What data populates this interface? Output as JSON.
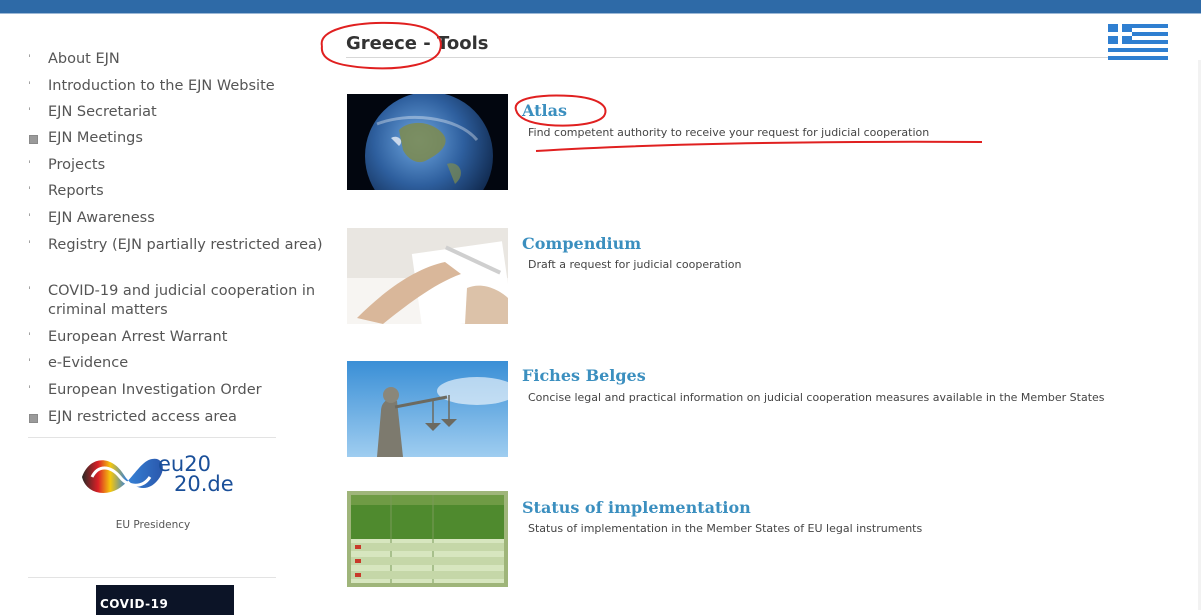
{
  "sidebar": {
    "items": [
      {
        "label": "About EJN"
      },
      {
        "label": "Introduction to the EJN Website"
      },
      {
        "label": "EJN Secretariat"
      },
      {
        "label": "EJN Meetings"
      },
      {
        "label": "Projects"
      },
      {
        "label": "Reports"
      },
      {
        "label": "EJN Awareness"
      },
      {
        "label": "Registry (EJN partially restricted area)"
      },
      {
        "label": "COVID-19 and judicial cooperation in criminal matters"
      },
      {
        "label": "European Arrest Warrant"
      },
      {
        "label": "e-Evidence"
      },
      {
        "label": "European Investigation Order"
      },
      {
        "label": "EJN restricted access area"
      }
    ],
    "presidency_logo_line1": "eu20",
    "presidency_logo_line2": "20.de",
    "presidency_caption": "EU Presidency",
    "covid_thumb_text": "COVID-19"
  },
  "main": {
    "title": "Greece - Tools",
    "tools": [
      {
        "title": "Atlas",
        "description": "Find competent authority to receive your request for judicial cooperation"
      },
      {
        "title": "Compendium",
        "description": "Draft a request for judicial cooperation"
      },
      {
        "title": "Fiches Belges",
        "description": "Concise legal and practical information on judicial cooperation measures available in the Member States"
      },
      {
        "title": "Status of implementation",
        "description": "Status of implementation in the Member States of EU legal instruments"
      }
    ]
  },
  "colors": {
    "accent": "#2e6aa7",
    "link": "#3b8fbf",
    "annotation": "#e02020"
  }
}
